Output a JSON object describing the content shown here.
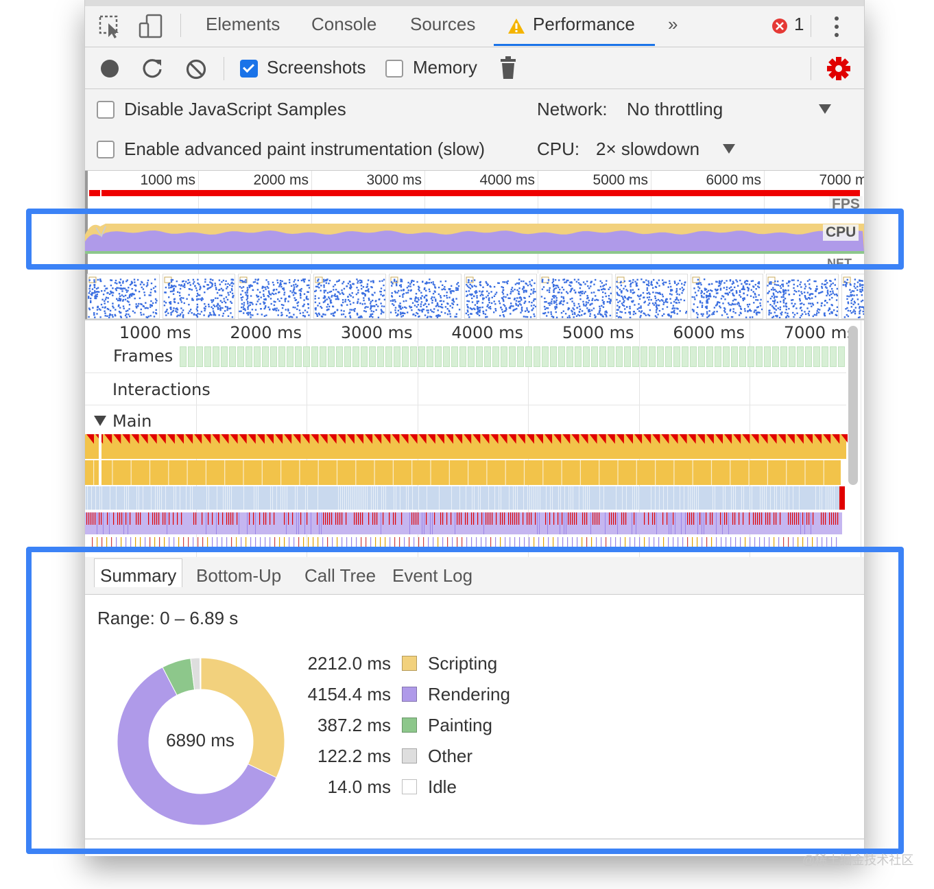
{
  "tabs": {
    "elements": "Elements",
    "console": "Console",
    "sources": "Sources",
    "performance": "Performance",
    "more": "»",
    "error_count": "1"
  },
  "toolbar": {
    "screenshots_label": "Screenshots",
    "screenshots_checked": true,
    "memory_label": "Memory",
    "memory_checked": false
  },
  "settings": {
    "disable_js_samples": "Disable JavaScript Samples",
    "enable_paint": "Enable advanced paint instrumentation (slow)",
    "network_label": "Network:",
    "network_value": "No throttling",
    "cpu_label": "CPU:",
    "cpu_value": "2× slowdown"
  },
  "overview": {
    "ticks": [
      "1000 ms",
      "2000 ms",
      "3000 ms",
      "4000 ms",
      "5000 ms",
      "6000 ms",
      "7000 ms"
    ],
    "fps_label": "FPS",
    "cpu_label": "CPU",
    "net_label": "NET"
  },
  "flame": {
    "ticks": [
      "1000 ms",
      "2000 ms",
      "3000 ms",
      "4000 ms",
      "5000 ms",
      "6000 ms",
      "7000 ms"
    ],
    "frames_label": "Frames",
    "interactions_label": "Interactions",
    "main_label": "Main"
  },
  "summary": {
    "tabs": [
      "Summary",
      "Bottom-Up",
      "Call Tree",
      "Event Log"
    ],
    "range": "Range: 0 – 6.89 s",
    "total": "6890 ms",
    "items": [
      {
        "value": "2212.0 ms",
        "label": "Scripting",
        "color": "#f2d17d"
      },
      {
        "value": "4154.4 ms",
        "label": "Rendering",
        "color": "#af9ae9"
      },
      {
        "value": "387.2 ms",
        "label": "Painting",
        "color": "#8dc78b"
      },
      {
        "value": "122.2 ms",
        "label": "Other",
        "color": "#dedede"
      },
      {
        "value": "14.0 ms",
        "label": "Idle",
        "color": "#ffffff"
      }
    ]
  },
  "colors": {
    "highlight": "#3b82f6",
    "accent": "#1a73e8",
    "record_red": "#e00000",
    "scripting": "#f2d17d",
    "rendering": "#af9ae9",
    "painting": "#8dc78b"
  },
  "watermark": "@稀土掘金技术社区"
}
